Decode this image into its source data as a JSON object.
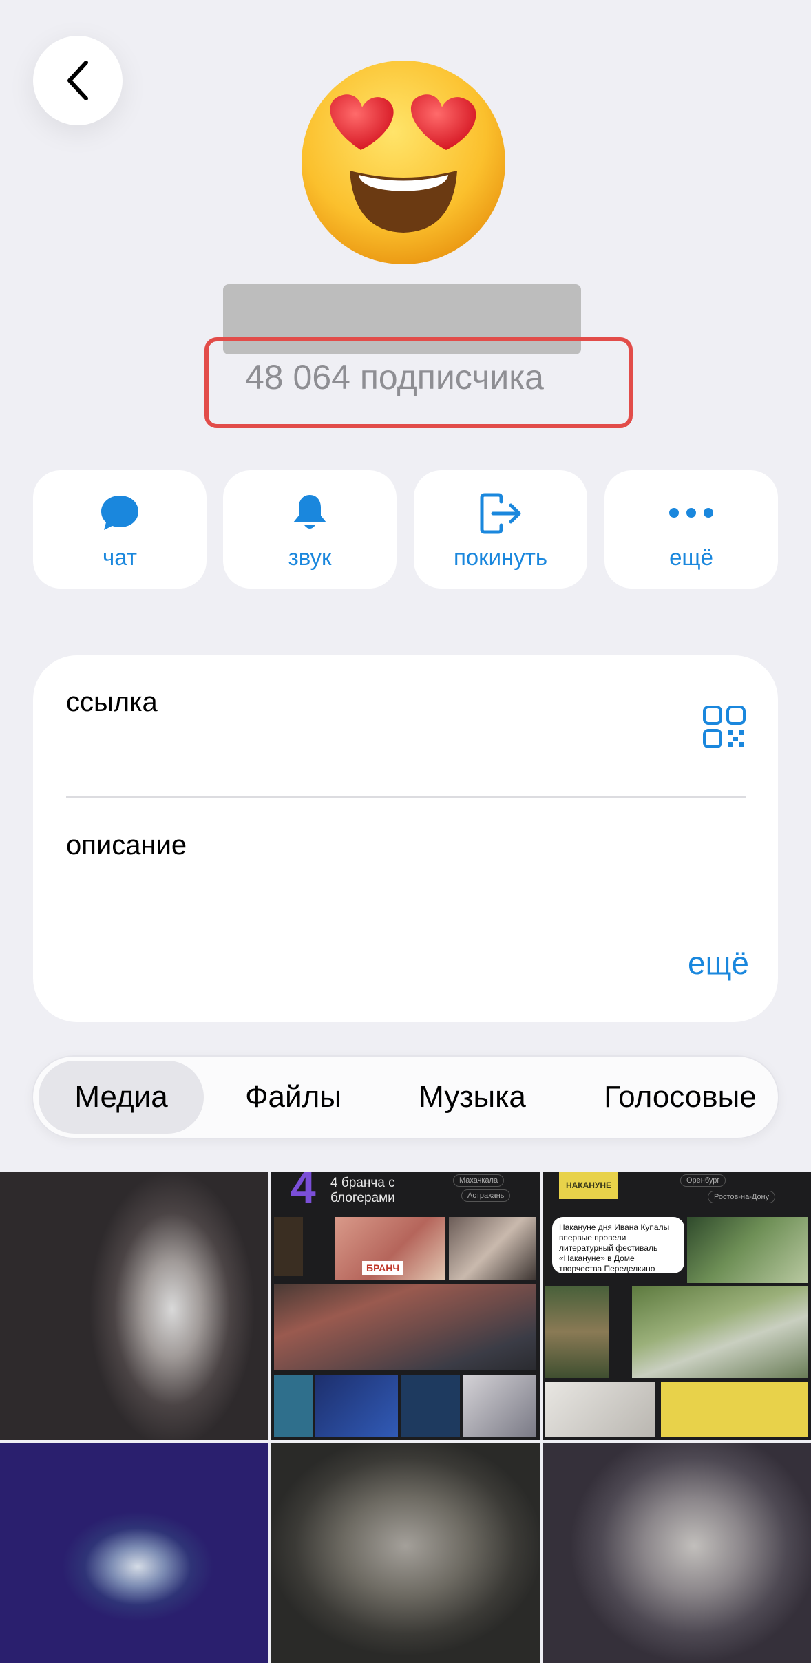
{
  "header": {
    "avatar_emoji": "heart-eyes-emoji",
    "subscribers": "48 064 подписчика"
  },
  "actions": [
    {
      "label": "чат",
      "icon": "chat-bubble-icon"
    },
    {
      "label": "звук",
      "icon": "bell-icon"
    },
    {
      "label": "покинуть",
      "icon": "leave-icon"
    },
    {
      "label": "ещё",
      "icon": "more-dots-icon"
    }
  ],
  "info": {
    "link_label": "ссылка",
    "description_label": "описание",
    "more_label": "ещё"
  },
  "tabs": {
    "items": [
      "Медиа",
      "Файлы",
      "Музыка",
      "Голосовые"
    ],
    "active": "Медиа"
  },
  "media": {
    "post1": {
      "heading": "4 бранча с блогерами",
      "cities": [
        "Махачкала",
        "Астрахань"
      ],
      "logo": "БРАНЧ"
    },
    "post2": {
      "logo": "НАКАНУНЕ",
      "cities": [
        "Оренбург",
        "Ростов-на-Дону"
      ],
      "quote": "Накануне дня Ивана Купалы впервые провели литературный фестиваль «Накануне» в Доме творчества Переделкино"
    }
  },
  "colors": {
    "accent": "#1a87dd",
    "highlight": "#e24c49",
    "background": "#efeff4"
  }
}
